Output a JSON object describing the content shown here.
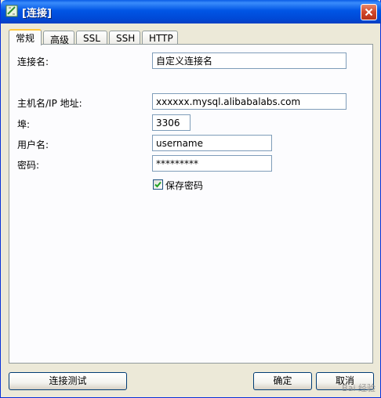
{
  "window": {
    "title": "[连接]",
    "close_label": "✕"
  },
  "tabs": [
    {
      "label": "常规",
      "active": true
    },
    {
      "label": "高级",
      "active": false
    },
    {
      "label": "SSL",
      "active": false
    },
    {
      "label": "SSH",
      "active": false
    },
    {
      "label": "HTTP",
      "active": false
    }
  ],
  "form": {
    "connection_name_label": "连接名:",
    "connection_name_value": "自定义连接名",
    "host_label": "主机名/IP 地址:",
    "host_value": "xxxxxx.mysql.alibabalabs.com",
    "port_label": "埠:",
    "port_value": "3306",
    "username_label": "用户名:",
    "username_value": "username",
    "password_label": "密码:",
    "password_value": "*********",
    "save_password_label": "保存密码",
    "save_password_checked": true
  },
  "buttons": {
    "test_connection": "连接测试",
    "ok": "确定",
    "cancel": "取消"
  },
  "watermark": "Bai 经验",
  "colors": {
    "title_bar": "#0055e5",
    "active_tab_accent": "#ffc83c",
    "close_button": "#d1462a"
  }
}
